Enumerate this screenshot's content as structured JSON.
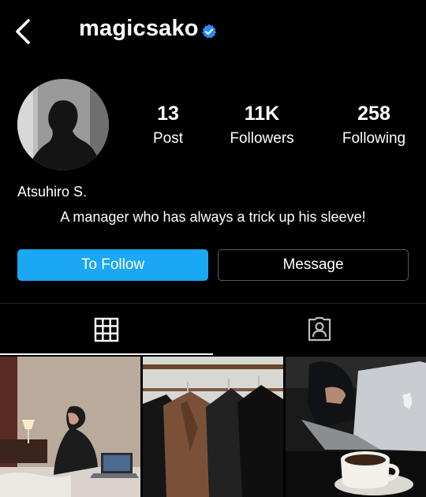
{
  "header": {
    "username": "magicsako",
    "back_icon": "chevron-left-icon",
    "verified_icon": "verified-badge-icon",
    "verified_color": "#2e8ef7"
  },
  "profile": {
    "full_name": "Atsuhiro S.",
    "bio": "A manager who has always a trick up his sleeve!",
    "stats": [
      {
        "value": "13",
        "label": "Post"
      },
      {
        "value": "11K",
        "label": "Followers"
      },
      {
        "value": "258",
        "label": "Following"
      }
    ]
  },
  "actions": {
    "follow_label": "To Follow",
    "message_label": "Message",
    "follow_color": "#1aa7f4"
  },
  "tabs": [
    {
      "icon": "grid-icon",
      "active": true
    },
    {
      "icon": "tagged-user-icon",
      "active": false
    }
  ],
  "posts": [
    {
      "subject": "person working on laptop in bed"
    },
    {
      "subject": "leather jackets on a clothing rack"
    },
    {
      "subject": "laptop with a cup of coffee"
    }
  ]
}
